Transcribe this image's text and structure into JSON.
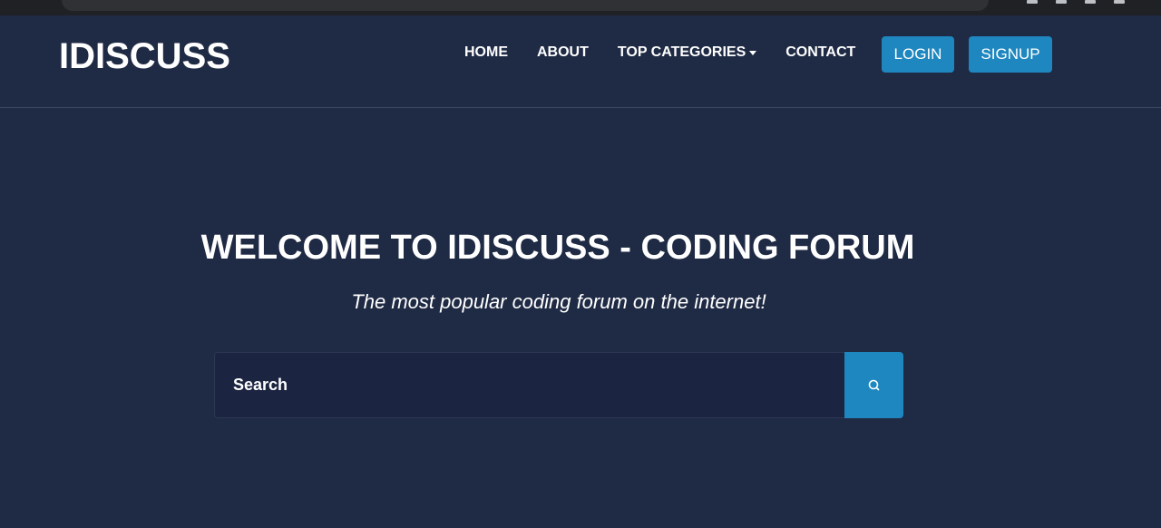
{
  "navbar": {
    "brand": "IDISCUSS",
    "links": [
      {
        "label": "HOME"
      },
      {
        "label": "ABOUT"
      },
      {
        "label": "TOP CATEGORIES"
      },
      {
        "label": "CONTACT"
      }
    ],
    "login_label": "LOGIN",
    "signup_label": "SIGNUP"
  },
  "hero": {
    "title": "WELCOME TO IDISCUSS - CODING FORUM",
    "subtitle": "The most popular coding forum on the internet!"
  },
  "search": {
    "placeholder": "Search",
    "icon": "search-icon"
  },
  "colors": {
    "background": "#1f2a44",
    "accent": "#1f87c0",
    "text": "#ffffff"
  }
}
